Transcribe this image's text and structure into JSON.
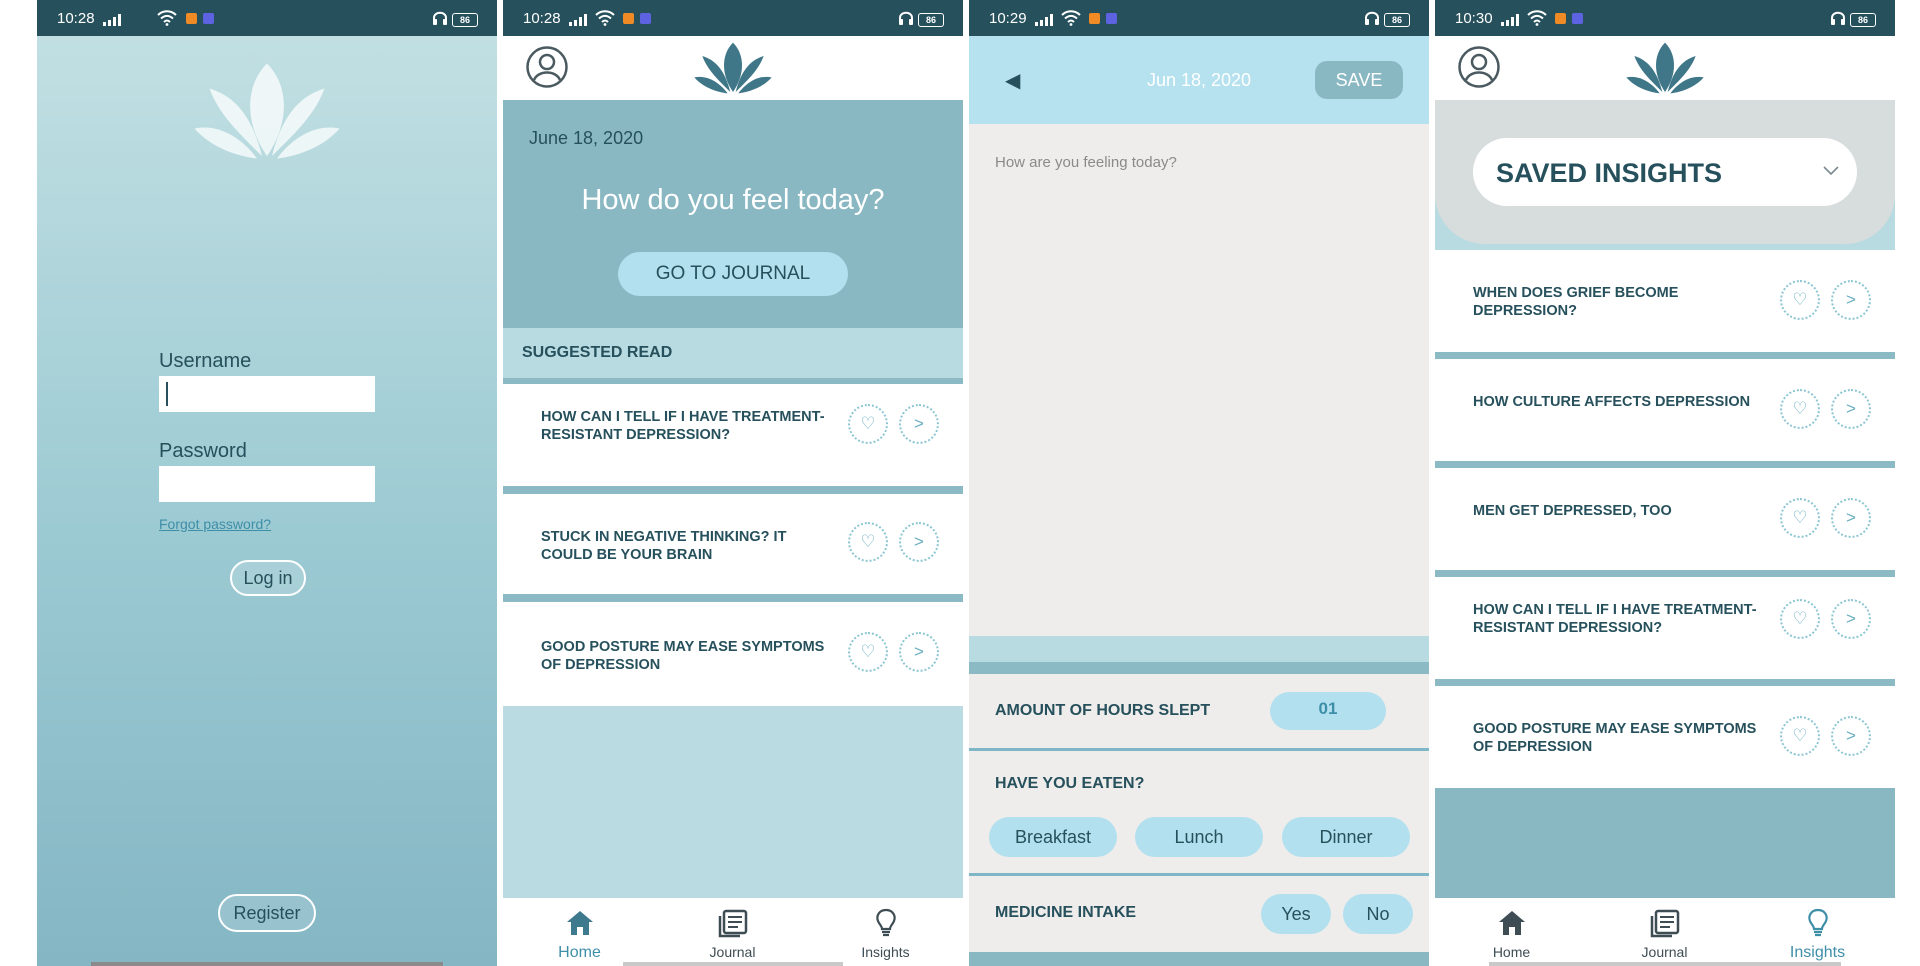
{
  "colors": {
    "status_bar": "#26505c",
    "teal_header": "#89b8c3",
    "light_teal": "#b8dbe1",
    "pill_blue": "#b2e0ee",
    "dark_text": "#26505c",
    "accent": "#3e8ea8",
    "journal_bg": "#eeedeb"
  },
  "screens": {
    "login": {
      "status_time": "10:28",
      "battery": "86",
      "username_label": "Username",
      "username_value": "",
      "password_label": "Password",
      "forgot_password": "Forgot password?",
      "login_button": "Log in",
      "register_button": "Register"
    },
    "home": {
      "status_time": "10:28",
      "battery": "86",
      "date": "June 18, 2020",
      "question": "How do you feel today?",
      "journal_button": "GO TO JOURNAL",
      "section_title": "SUGGESTED READ",
      "articles": [
        {
          "title": "HOW CAN I TELL IF I HAVE TREATMENT-RESISTANT DEPRESSION?",
          "like_icon": "heart-icon",
          "open_icon": ">"
        },
        {
          "title": "STUCK IN NEGATIVE THINKING? IT COULD BE YOUR BRAIN",
          "like_icon": "heart-icon",
          "open_icon": ">"
        },
        {
          "title": "GOOD POSTURE MAY EASE SYMPTOMS OF DEPRESSION",
          "like_icon": "heart-icon",
          "open_icon": ">"
        }
      ],
      "nav": [
        {
          "label": "Home",
          "icon": "home-icon",
          "active": true
        },
        {
          "label": "Journal",
          "icon": "journal-icon",
          "active": false
        },
        {
          "label": "Insights",
          "icon": "lightbulb-icon",
          "active": false
        }
      ]
    },
    "journal": {
      "status_time": "10:29",
      "battery": "86",
      "back_icon": "◀",
      "date": "Jun 18, 2020",
      "save_button": "SAVE",
      "entry_placeholder": "How are you feeling today?",
      "hours_label": "AMOUNT OF HOURS SLEPT",
      "hours_value": "01",
      "eaten_label": "HAVE YOU EATEN?",
      "meals": [
        "Breakfast",
        "Lunch",
        "Dinner"
      ],
      "medicine_label": "MEDICINE INTAKE",
      "medicine_options": [
        "Yes",
        "No"
      ]
    },
    "insights": {
      "status_time": "10:30",
      "battery": "86",
      "dropdown_value": "SAVED INSIGHTS",
      "articles": [
        {
          "title": "WHEN DOES GRIEF BECOME DEPRESSION?"
        },
        {
          "title": "HOW CULTURE AFFECTS DEPRESSION"
        },
        {
          "title": "MEN GET DEPRESSED, TOO"
        },
        {
          "title": "HOW CAN I TELL IF I HAVE TREATMENT-RESISTANT DEPRESSION?"
        },
        {
          "title": "GOOD POSTURE MAY EASE SYMPTOMS OF DEPRESSION"
        }
      ],
      "nav": [
        {
          "label": "Home",
          "icon": "home-icon",
          "active": false
        },
        {
          "label": "Journal",
          "icon": "journal-icon",
          "active": false
        },
        {
          "label": "Insights",
          "icon": "lightbulb-icon",
          "active": true
        }
      ]
    }
  }
}
